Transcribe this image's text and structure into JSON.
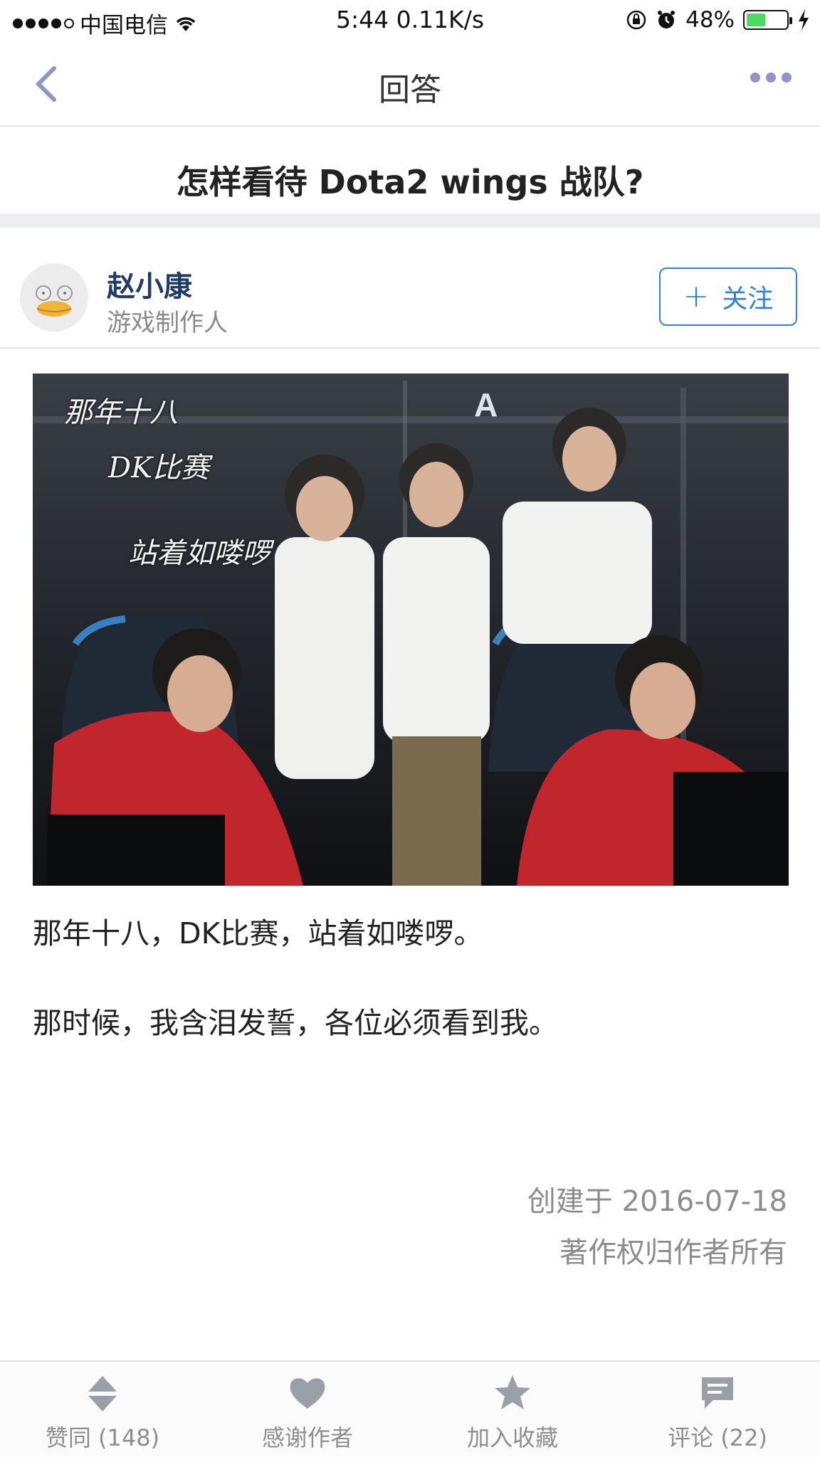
{
  "status_bar": {
    "carrier": "中国电信",
    "time_speed": "5:44 0.11K/s",
    "battery": "48%",
    "battery_level": 0.48,
    "battery_color": "#4cd964"
  },
  "navbar": {
    "title": "回答",
    "back_icon": "chevron-left-icon",
    "more_icon": "more-icon",
    "accent": "#8f95c8"
  },
  "question": {
    "title": "怎样看待 Dota2 wings 战队?"
  },
  "author": {
    "name": "赵小康",
    "title": "游戏制作人",
    "follow_label": "关注",
    "follow_icon": "plus-icon",
    "follow_color": "#2b83df"
  },
  "image": {
    "caption_lines": [
      "那年十八",
      "DK比赛",
      "站着如喽啰"
    ]
  },
  "content": {
    "paragraphs": [
      "那年十八，DK比赛，站着如喽啰。",
      "那时候，我含泪发誓，各位必须看到我。"
    ]
  },
  "meta": {
    "created": "创建于 2016-07-18",
    "copyright": "著作权归作者所有"
  },
  "tabbar": {
    "items": [
      {
        "label": "赞同 (148)",
        "icon": "vote-icon"
      },
      {
        "label": "感谢作者",
        "icon": "heart-icon"
      },
      {
        "label": "加入收藏",
        "icon": "star-icon"
      },
      {
        "label": "评论 (22)",
        "icon": "comment-icon"
      }
    ],
    "icon_color": "#9aa0a8"
  }
}
